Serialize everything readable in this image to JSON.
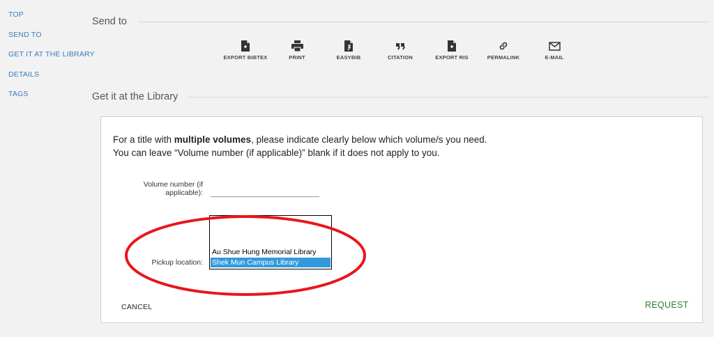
{
  "nav": {
    "items": [
      {
        "label": "TOP"
      },
      {
        "label": "SEND TO"
      },
      {
        "label": "GET IT AT THE LIBRARY"
      },
      {
        "label": "DETAILS"
      },
      {
        "label": "TAGS"
      }
    ]
  },
  "send_to": {
    "title": "Send to",
    "actions": [
      {
        "label": "EXPORT BIBTEX",
        "icon": "export-bibtex-icon"
      },
      {
        "label": "PRINT",
        "icon": "print-icon"
      },
      {
        "label": "EASYBIB",
        "icon": "easybib-icon"
      },
      {
        "label": "CITATION",
        "icon": "quote-icon"
      },
      {
        "label": "EXPORT RIS",
        "icon": "export-ris-icon"
      },
      {
        "label": "PERMALINK",
        "icon": "link-icon"
      },
      {
        "label": "E-MAIL",
        "icon": "mail-icon"
      }
    ]
  },
  "library": {
    "title": "Get it at the Library"
  },
  "request_form": {
    "intro_pre": "For a title with ",
    "intro_bold": "multiple volumes",
    "intro_post": ", please indicate clearly below which volume/s you need.",
    "intro_line2": "You can leave “Volume number (if applicable)” blank if it does not apply to you.",
    "volume_label": "Volume number (if applicable):",
    "volume_value": "",
    "pickup_label": "Pickup location:",
    "pickup_options": [
      {
        "label": "Au Shue Hung Memorial Library",
        "selected": false
      },
      {
        "label": "Shek Mun Campus Library",
        "selected": true
      }
    ],
    "cancel_label": "CANCEL",
    "request_label": "REQUEST"
  },
  "colors": {
    "nav_link": "#3d7ab8",
    "request": "#2e7d32",
    "selected_option": "#3399dd",
    "annotation": "#e8161b"
  }
}
